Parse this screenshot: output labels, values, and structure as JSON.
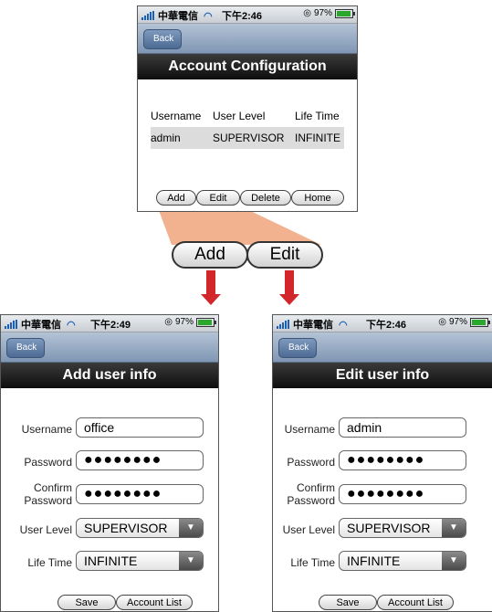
{
  "top": {
    "status": {
      "carrier": "中華電信",
      "time": "下午2:46",
      "battery": "97%",
      "battery_level": 0.97
    },
    "back_label": "Back",
    "title": "Account Configuration",
    "table": {
      "headers": [
        "Username",
        "User Level",
        "Life Time"
      ],
      "rows": [
        [
          "admin",
          "SUPERVISOR",
          "INFINITE"
        ]
      ]
    },
    "buttons": [
      "Add",
      "Edit",
      "Delete",
      "Home"
    ]
  },
  "callout": {
    "add_label": "Add",
    "edit_label": "Edit"
  },
  "add": {
    "status": {
      "carrier": "中華電信",
      "time": "下午2:49",
      "battery": "97%",
      "battery_level": 0.97
    },
    "back_label": "Back",
    "title": "Add user info",
    "labels": {
      "username": "Username",
      "password": "Password",
      "confirm": "Confirm Password",
      "confirm_l1": "Confirm",
      "confirm_l2": "Password",
      "level": "User Level",
      "life": "Life Time"
    },
    "values": {
      "username": "office",
      "password": "●●●●●●●●",
      "confirm": "●●●●●●●●",
      "level": "SUPERVISOR",
      "life": "INFINITE"
    },
    "buttons": {
      "save": "Save",
      "account_list": "Account List"
    }
  },
  "edit": {
    "status": {
      "carrier": "中華電信",
      "time": "下午2:46",
      "battery": "97%",
      "battery_level": 0.97
    },
    "back_label": "Back",
    "title": "Edit user info",
    "labels": {
      "username": "Username",
      "password": "Password",
      "confirm": "Confirm Password",
      "confirm_l1": "Confirm",
      "confirm_l2": "Password",
      "level": "User Level",
      "life": "Life Time"
    },
    "values": {
      "username": "admin",
      "password": "●●●●●●●●",
      "confirm": "●●●●●●●●",
      "level": "SUPERVISOR",
      "life": "INFINITE"
    },
    "buttons": {
      "save": "Save",
      "account_list": "Account List"
    }
  },
  "colors": {
    "highlight": "#f3b28f",
    "arrow": "#d3262b",
    "nav": "#7f96b3",
    "title_bg": "#1a1a1a"
  }
}
